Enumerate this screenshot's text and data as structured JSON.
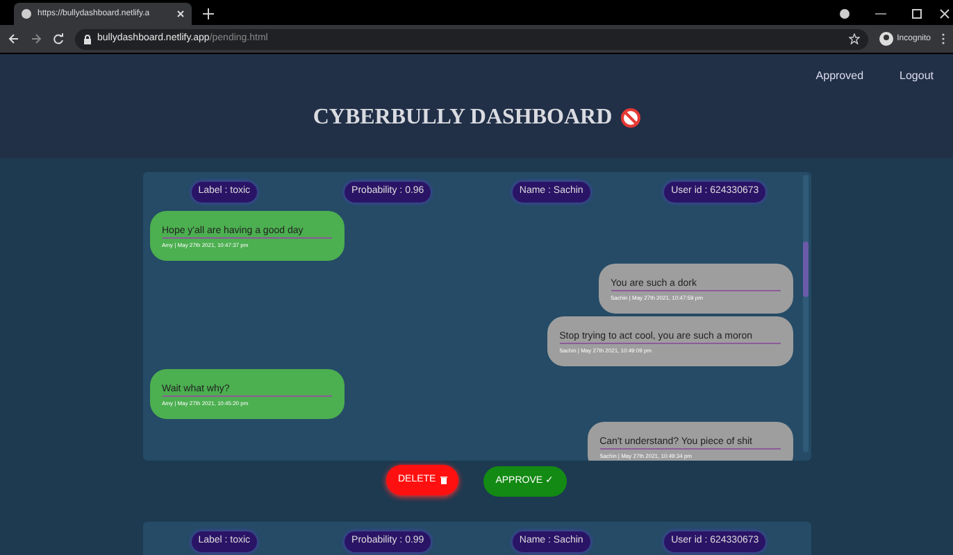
{
  "browser": {
    "tab_title": "https://bullydashboard.netlify.a",
    "url_host": "bullydashboard.netlify.app",
    "url_path": "/pending.html",
    "profile": "Incognito"
  },
  "nav": [
    "Approved",
    "Logout"
  ],
  "title": "CYBERBULLY DASHBOARD",
  "cards": [
    {
      "tags": [
        "Label : toxic",
        "Probability : 0.96",
        "Name : Sachin",
        "User id : 624330673"
      ],
      "messages": [
        {
          "kind": "other",
          "text": "Hope y'all are having a good day",
          "meta": "Amy | May 27th 2021, 10:47:37 pm"
        },
        {
          "kind": "flagged",
          "text": "You are such a dork",
          "meta": "Sachin | May 27th 2021, 10:47:59 pm"
        },
        {
          "kind": "flagged",
          "text": "Stop trying to act cool, you are such a moron",
          "meta": "Sachin | May 27th 2021, 10:49:09 pm"
        },
        {
          "kind": "other",
          "text": "Wait what why?",
          "meta": "Amy | May 27th 2021, 10:45:20 pm"
        },
        {
          "kind": "flagged",
          "text": "Can't understand? You piece of shit",
          "meta": "Sachin | May 27th 2021, 10:49:34 pm"
        }
      ],
      "delete": "DELETE",
      "approve": "APPROVE ✓"
    },
    {
      "tags": [
        "Label : toxic",
        "Probability : 0.99",
        "Name : Sachin",
        "User id : 624330673"
      ]
    }
  ]
}
